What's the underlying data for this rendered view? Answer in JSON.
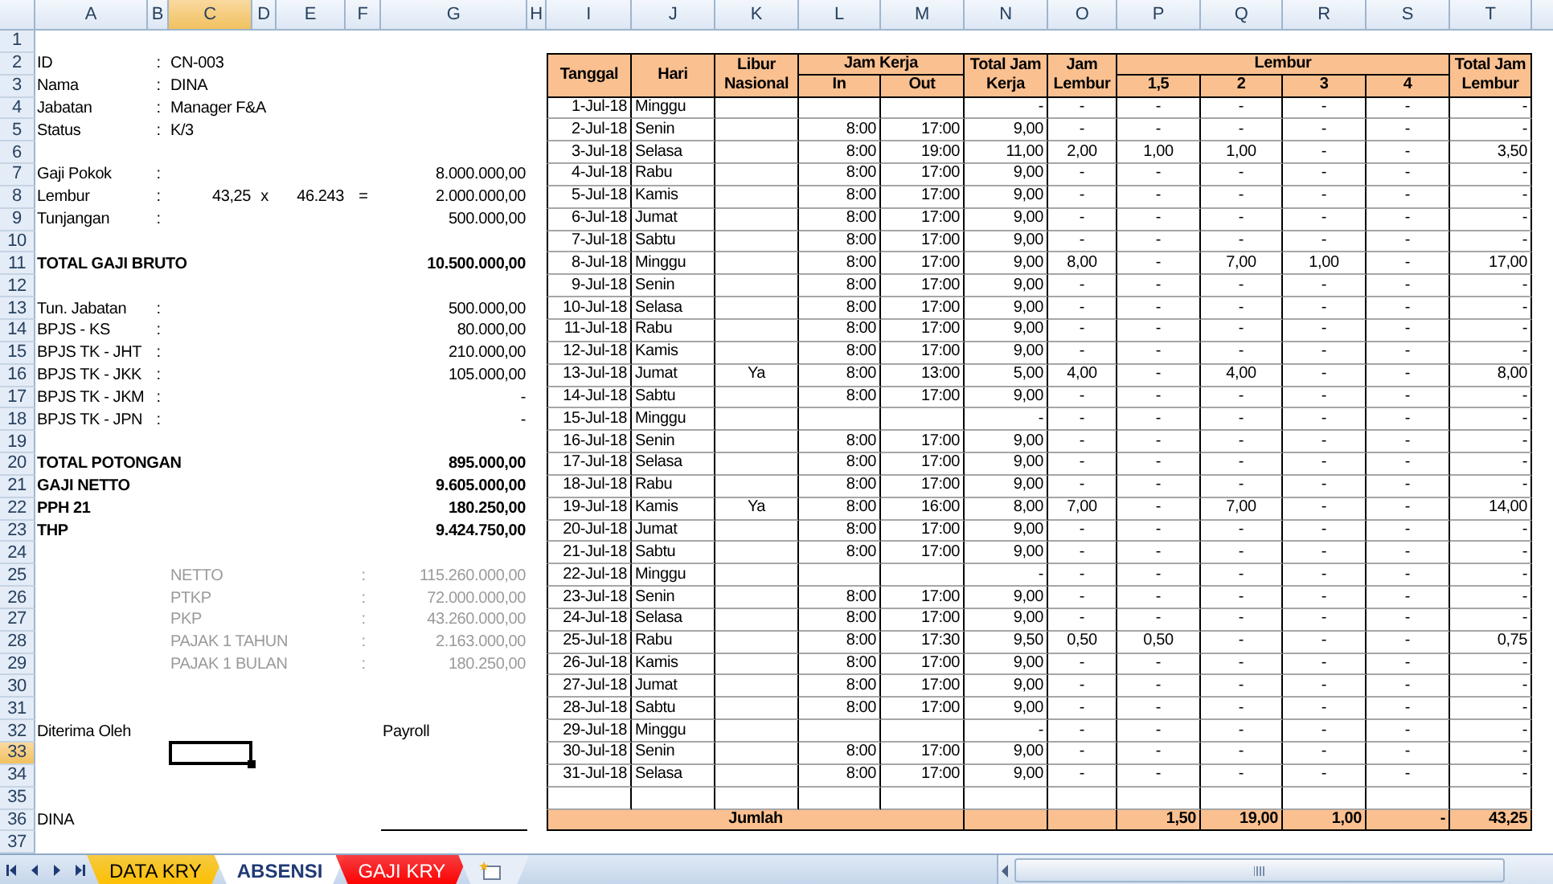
{
  "column_headers": [
    {
      "label": "A",
      "selected": false
    },
    {
      "label": "B",
      "selected": false
    },
    {
      "label": "C",
      "selected": true
    },
    {
      "label": "D",
      "selected": false
    },
    {
      "label": "E",
      "selected": false
    },
    {
      "label": "F",
      "selected": false
    },
    {
      "label": "G",
      "selected": false
    },
    {
      "label": "H",
      "selected": false
    },
    {
      "label": "I",
      "selected": false
    },
    {
      "label": "J",
      "selected": false
    },
    {
      "label": "K",
      "selected": false
    },
    {
      "label": "L",
      "selected": false
    },
    {
      "label": "M",
      "selected": false
    },
    {
      "label": "N",
      "selected": false
    },
    {
      "label": "O",
      "selected": false
    },
    {
      "label": "P",
      "selected": false
    },
    {
      "label": "Q",
      "selected": false
    },
    {
      "label": "R",
      "selected": false
    },
    {
      "label": "S",
      "selected": false
    },
    {
      "label": "T",
      "selected": false
    }
  ],
  "row_headers": [
    {
      "label": "1",
      "selected": false
    },
    {
      "label": "2",
      "selected": false
    },
    {
      "label": "3",
      "selected": false
    },
    {
      "label": "4",
      "selected": false
    },
    {
      "label": "5",
      "selected": false
    },
    {
      "label": "6",
      "selected": false
    },
    {
      "label": "7",
      "selected": false
    },
    {
      "label": "8",
      "selected": false
    },
    {
      "label": "9",
      "selected": false
    },
    {
      "label": "10",
      "selected": false
    },
    {
      "label": "11",
      "selected": false
    },
    {
      "label": "12",
      "selected": false
    },
    {
      "label": "13",
      "selected": false
    },
    {
      "label": "14",
      "selected": false
    },
    {
      "label": "15",
      "selected": false
    },
    {
      "label": "16",
      "selected": false
    },
    {
      "label": "17",
      "selected": false
    },
    {
      "label": "18",
      "selected": false
    },
    {
      "label": "19",
      "selected": false
    },
    {
      "label": "20",
      "selected": false
    },
    {
      "label": "21",
      "selected": false
    },
    {
      "label": "22",
      "selected": false
    },
    {
      "label": "23",
      "selected": false
    },
    {
      "label": "24",
      "selected": false
    },
    {
      "label": "25",
      "selected": false
    },
    {
      "label": "26",
      "selected": false
    },
    {
      "label": "27",
      "selected": false
    },
    {
      "label": "28",
      "selected": false
    },
    {
      "label": "29",
      "selected": false
    },
    {
      "label": "30",
      "selected": false
    },
    {
      "label": "31",
      "selected": false
    },
    {
      "label": "32",
      "selected": false
    },
    {
      "label": "33",
      "selected": true
    },
    {
      "label": "34",
      "selected": false
    },
    {
      "label": "35",
      "selected": false
    },
    {
      "label": "36",
      "selected": false
    },
    {
      "label": "37",
      "selected": false
    }
  ],
  "payslip": {
    "info": [
      {
        "label": "ID",
        "separator": ":",
        "value": "CN-003"
      },
      {
        "label": "Nama",
        "separator": ":",
        "value": "DINA"
      },
      {
        "label": "Jabatan",
        "separator": ":",
        "value": "Manager F&A"
      },
      {
        "label": "Status",
        "separator": ":",
        "value": "K/3"
      }
    ],
    "earnings": [
      {
        "label": "Gaji Pokok",
        "separator": ":",
        "amount": "8.000.000,00"
      },
      {
        "label": "Lembur",
        "separator": ":",
        "hours": "43,25",
        "times": "x",
        "rate": "46.243",
        "equals": "=",
        "amount": "2.000.000,00"
      },
      {
        "label": "Tunjangan",
        "separator": ":",
        "amount": "500.000,00"
      }
    ],
    "gross_total": {
      "label": "TOTAL GAJI BRUTO",
      "amount": "10.500.000,00"
    },
    "deductions": [
      {
        "label": "Tun. Jabatan",
        "separator": ":",
        "amount": "500.000,00"
      },
      {
        "label": "BPJS - KS",
        "separator": ":",
        "amount": "80.000,00"
      },
      {
        "label": "BPJS TK - JHT",
        "separator": ":",
        "amount": "210.000,00"
      },
      {
        "label": "BPJS TK - JKK",
        "separator": ":",
        "amount": "105.000,00"
      },
      {
        "label": "BPJS TK - JKM",
        "separator": ":",
        "amount": "-"
      },
      {
        "label": "BPJS TK - JPN",
        "separator": ":",
        "amount": "-"
      }
    ],
    "summary": [
      {
        "label": "TOTAL POTONGAN",
        "amount": "895.000,00"
      },
      {
        "label": "GAJI NETTO",
        "amount": "9.605.000,00"
      },
      {
        "label": "PPH 21",
        "amount": "180.250,00"
      },
      {
        "label": "THP",
        "amount": "9.424.750,00"
      }
    ],
    "tax_calculation": [
      {
        "label": "NETTO",
        "separator": ":",
        "amount": "115.260.000,00"
      },
      {
        "label": "PTKP",
        "separator": ":",
        "amount": "72.000.000,00"
      },
      {
        "label": "PKP",
        "separator": ":",
        "amount": "43.260.000,00"
      },
      {
        "label": "PAJAK 1 TAHUN",
        "separator": ":",
        "amount": "2.163.000,00"
      },
      {
        "label": "PAJAK 1 BULAN",
        "separator": ":",
        "amount": "180.250,00"
      }
    ],
    "signature": {
      "received_label": "Diterima Oleh",
      "payroll_label": "Payroll",
      "name": "DINA"
    }
  },
  "attendance": {
    "headers": {
      "date": "Tanggal",
      "day": "Hari",
      "holiday": "Libur Nasional",
      "work_time": "Jam Kerja",
      "time_in": "In",
      "time_out": "Out",
      "work_hours": "Total Jam Kerja",
      "overtime_hours": "Jam Lembur",
      "overtime": "Lembur",
      "ot_1_5": "1,5",
      "ot_2": "2",
      "ot_3": "3",
      "ot_4": "4",
      "total_overtime": "Total Jam Lembur"
    },
    "rows": [
      {
        "date": "1-Jul-18",
        "day": "Minggu",
        "work_hours": "-",
        "overtime_hours": "-",
        "ot_1_5": "-",
        "ot_2": "-",
        "ot_3": "-",
        "ot_4": "-",
        "total_overtime": "-"
      },
      {
        "date": "2-Jul-18",
        "day": "Senin",
        "time_in": "8:00",
        "time_out": "17:00",
        "work_hours": "9,00",
        "overtime_hours": "-",
        "ot_1_5": "-",
        "ot_2": "-",
        "ot_3": "-",
        "ot_4": "-",
        "total_overtime": "-"
      },
      {
        "date": "3-Jul-18",
        "day": "Selasa",
        "time_in": "8:00",
        "time_out": "19:00",
        "work_hours": "11,00",
        "overtime_hours": "2,00",
        "ot_1_5": "1,00",
        "ot_2": "1,00",
        "ot_3": "-",
        "ot_4": "-",
        "total_overtime": "3,50"
      },
      {
        "date": "4-Jul-18",
        "day": "Rabu",
        "time_in": "8:00",
        "time_out": "17:00",
        "work_hours": "9,00",
        "overtime_hours": "-",
        "ot_1_5": "-",
        "ot_2": "-",
        "ot_3": "-",
        "ot_4": "-",
        "total_overtime": "-"
      },
      {
        "date": "5-Jul-18",
        "day": "Kamis",
        "time_in": "8:00",
        "time_out": "17:00",
        "work_hours": "9,00",
        "overtime_hours": "-",
        "ot_1_5": "-",
        "ot_2": "-",
        "ot_3": "-",
        "ot_4": "-",
        "total_overtime": "-"
      },
      {
        "date": "6-Jul-18",
        "day": "Jumat",
        "time_in": "8:00",
        "time_out": "17:00",
        "work_hours": "9,00",
        "overtime_hours": "-",
        "ot_1_5": "-",
        "ot_2": "-",
        "ot_3": "-",
        "ot_4": "-",
        "total_overtime": "-"
      },
      {
        "date": "7-Jul-18",
        "day": "Sabtu",
        "time_in": "8:00",
        "time_out": "17:00",
        "work_hours": "9,00",
        "overtime_hours": "-",
        "ot_1_5": "-",
        "ot_2": "-",
        "ot_3": "-",
        "ot_4": "-",
        "total_overtime": "-"
      },
      {
        "date": "8-Jul-18",
        "day": "Minggu",
        "time_in": "8:00",
        "time_out": "17:00",
        "work_hours": "9,00",
        "overtime_hours": "8,00",
        "ot_1_5": "-",
        "ot_2": "7,00",
        "ot_3": "1,00",
        "ot_4": "-",
        "total_overtime": "17,00"
      },
      {
        "date": "9-Jul-18",
        "day": "Senin",
        "time_in": "8:00",
        "time_out": "17:00",
        "work_hours": "9,00",
        "overtime_hours": "-",
        "ot_1_5": "-",
        "ot_2": "-",
        "ot_3": "-",
        "ot_4": "-",
        "total_overtime": "-"
      },
      {
        "date": "10-Jul-18",
        "day": "Selasa",
        "time_in": "8:00",
        "time_out": "17:00",
        "work_hours": "9,00",
        "overtime_hours": "-",
        "ot_1_5": "-",
        "ot_2": "-",
        "ot_3": "-",
        "ot_4": "-",
        "total_overtime": "-"
      },
      {
        "date": "11-Jul-18",
        "day": "Rabu",
        "time_in": "8:00",
        "time_out": "17:00",
        "work_hours": "9,00",
        "overtime_hours": "-",
        "ot_1_5": "-",
        "ot_2": "-",
        "ot_3": "-",
        "ot_4": "-",
        "total_overtime": "-"
      },
      {
        "date": "12-Jul-18",
        "day": "Kamis",
        "time_in": "8:00",
        "time_out": "17:00",
        "work_hours": "9,00",
        "overtime_hours": "-",
        "ot_1_5": "-",
        "ot_2": "-",
        "ot_3": "-",
        "ot_4": "-",
        "total_overtime": "-"
      },
      {
        "date": "13-Jul-18",
        "day": "Jumat",
        "holiday": "Ya",
        "time_in": "8:00",
        "time_out": "13:00",
        "work_hours": "5,00",
        "overtime_hours": "4,00",
        "ot_1_5": "-",
        "ot_2": "4,00",
        "ot_3": "-",
        "ot_4": "-",
        "total_overtime": "8,00"
      },
      {
        "date": "14-Jul-18",
        "day": "Sabtu",
        "time_in": "8:00",
        "time_out": "17:00",
        "work_hours": "9,00",
        "overtime_hours": "-",
        "ot_1_5": "-",
        "ot_2": "-",
        "ot_3": "-",
        "ot_4": "-",
        "total_overtime": "-"
      },
      {
        "date": "15-Jul-18",
        "day": "Minggu",
        "work_hours": "-",
        "overtime_hours": "-",
        "ot_1_5": "-",
        "ot_2": "-",
        "ot_3": "-",
        "ot_4": "-",
        "total_overtime": "-"
      },
      {
        "date": "16-Jul-18",
        "day": "Senin",
        "time_in": "8:00",
        "time_out": "17:00",
        "work_hours": "9,00",
        "overtime_hours": "-",
        "ot_1_5": "-",
        "ot_2": "-",
        "ot_3": "-",
        "ot_4": "-",
        "total_overtime": "-"
      },
      {
        "date": "17-Jul-18",
        "day": "Selasa",
        "time_in": "8:00",
        "time_out": "17:00",
        "work_hours": "9,00",
        "overtime_hours": "-",
        "ot_1_5": "-",
        "ot_2": "-",
        "ot_3": "-",
        "ot_4": "-",
        "total_overtime": "-"
      },
      {
        "date": "18-Jul-18",
        "day": "Rabu",
        "time_in": "8:00",
        "time_out": "17:00",
        "work_hours": "9,00",
        "overtime_hours": "-",
        "ot_1_5": "-",
        "ot_2": "-",
        "ot_3": "-",
        "ot_4": "-",
        "total_overtime": "-"
      },
      {
        "date": "19-Jul-18",
        "day": "Kamis",
        "holiday": "Ya",
        "time_in": "8:00",
        "time_out": "16:00",
        "work_hours": "8,00",
        "overtime_hours": "7,00",
        "ot_1_5": "-",
        "ot_2": "7,00",
        "ot_3": "-",
        "ot_4": "-",
        "total_overtime": "14,00"
      },
      {
        "date": "20-Jul-18",
        "day": "Jumat",
        "time_in": "8:00",
        "time_out": "17:00",
        "work_hours": "9,00",
        "overtime_hours": "-",
        "ot_1_5": "-",
        "ot_2": "-",
        "ot_3": "-",
        "ot_4": "-",
        "total_overtime": "-"
      },
      {
        "date": "21-Jul-18",
        "day": "Sabtu",
        "time_in": "8:00",
        "time_out": "17:00",
        "work_hours": "9,00",
        "overtime_hours": "-",
        "ot_1_5": "-",
        "ot_2": "-",
        "ot_3": "-",
        "ot_4": "-",
        "total_overtime": "-"
      },
      {
        "date": "22-Jul-18",
        "day": "Minggu",
        "work_hours": "-",
        "overtime_hours": "-",
        "ot_1_5": "-",
        "ot_2": "-",
        "ot_3": "-",
        "ot_4": "-",
        "total_overtime": "-"
      },
      {
        "date": "23-Jul-18",
        "day": "Senin",
        "time_in": "8:00",
        "time_out": "17:00",
        "work_hours": "9,00",
        "overtime_hours": "-",
        "ot_1_5": "-",
        "ot_2": "-",
        "ot_3": "-",
        "ot_4": "-",
        "total_overtime": "-"
      },
      {
        "date": "24-Jul-18",
        "day": "Selasa",
        "time_in": "8:00",
        "time_out": "17:00",
        "work_hours": "9,00",
        "overtime_hours": "-",
        "ot_1_5": "-",
        "ot_2": "-",
        "ot_3": "-",
        "ot_4": "-",
        "total_overtime": "-"
      },
      {
        "date": "25-Jul-18",
        "day": "Rabu",
        "time_in": "8:00",
        "time_out": "17:30",
        "work_hours": "9,50",
        "overtime_hours": "0,50",
        "ot_1_5": "0,50",
        "ot_2": "-",
        "ot_3": "-",
        "ot_4": "-",
        "total_overtime": "0,75"
      },
      {
        "date": "26-Jul-18",
        "day": "Kamis",
        "time_in": "8:00",
        "time_out": "17:00",
        "work_hours": "9,00",
        "overtime_hours": "-",
        "ot_1_5": "-",
        "ot_2": "-",
        "ot_3": "-",
        "ot_4": "-",
        "total_overtime": "-"
      },
      {
        "date": "27-Jul-18",
        "day": "Jumat",
        "time_in": "8:00",
        "time_out": "17:00",
        "work_hours": "9,00",
        "overtime_hours": "-",
        "ot_1_5": "-",
        "ot_2": "-",
        "ot_3": "-",
        "ot_4": "-",
        "total_overtime": "-"
      },
      {
        "date": "28-Jul-18",
        "day": "Sabtu",
        "time_in": "8:00",
        "time_out": "17:00",
        "work_hours": "9,00",
        "overtime_hours": "-",
        "ot_1_5": "-",
        "ot_2": "-",
        "ot_3": "-",
        "ot_4": "-",
        "total_overtime": "-"
      },
      {
        "date": "29-Jul-18",
        "day": "Minggu",
        "work_hours": "-",
        "overtime_hours": "-",
        "ot_1_5": "-",
        "ot_2": "-",
        "ot_3": "-",
        "ot_4": "-",
        "total_overtime": "-"
      },
      {
        "date": "30-Jul-18",
        "day": "Senin",
        "time_in": "8:00",
        "time_out": "17:00",
        "work_hours": "9,00",
        "overtime_hours": "-",
        "ot_1_5": "-",
        "ot_2": "-",
        "ot_3": "-",
        "ot_4": "-",
        "total_overtime": "-"
      },
      {
        "date": "31-Jul-18",
        "day": "Selasa",
        "time_in": "8:00",
        "time_out": "17:00",
        "work_hours": "9,00",
        "overtime_hours": "-",
        "ot_1_5": "-",
        "ot_2": "-",
        "ot_3": "-",
        "ot_4": "-",
        "total_overtime": "-"
      }
    ],
    "total": {
      "label": "Jumlah",
      "ot_1_5": "1,50",
      "ot_2": "19,00",
      "ot_3": "1,00",
      "ot_4": "-",
      "total_overtime": "43,25"
    }
  },
  "sheet_tabs": [
    {
      "label": "DATA KRY",
      "selected": false,
      "color": "#ffc000"
    },
    {
      "label": "ABSENSI",
      "selected": true,
      "color": "#ffffff"
    },
    {
      "label": "GAJI KRY",
      "selected": false,
      "color": "#ff0000"
    }
  ]
}
